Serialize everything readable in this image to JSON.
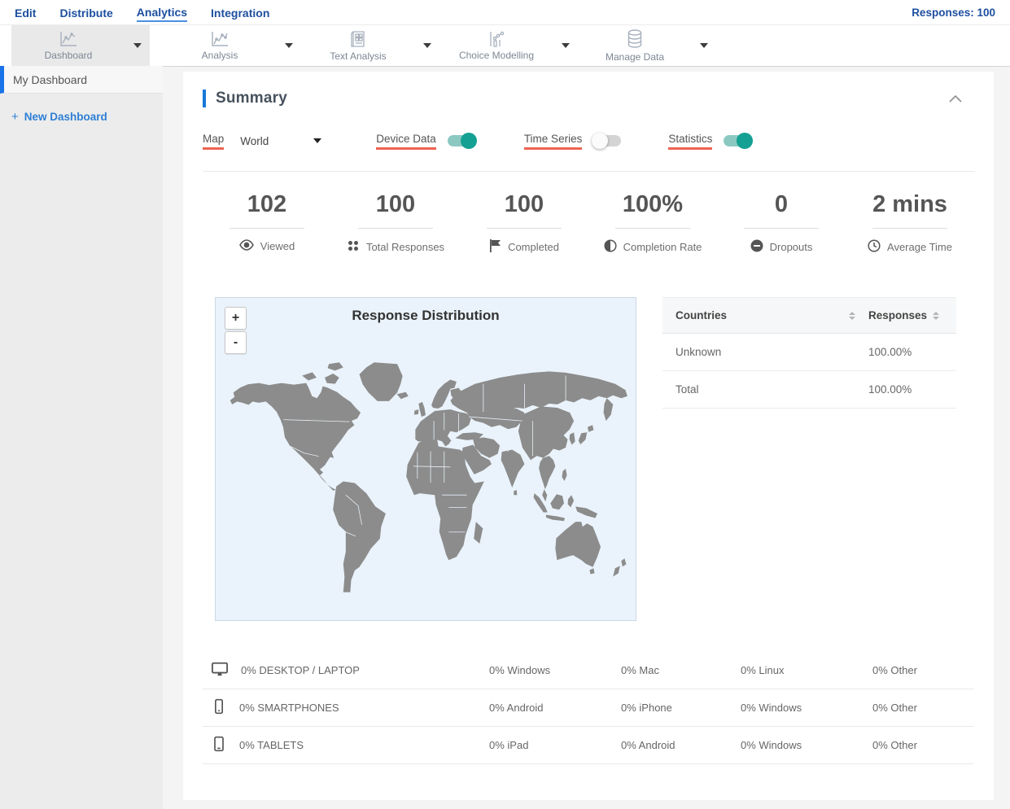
{
  "nav": {
    "items": [
      "Edit",
      "Distribute",
      "Analytics",
      "Integration"
    ],
    "active": "Analytics",
    "responses": "Responses: 100"
  },
  "toolbar": {
    "items": [
      {
        "label": "Dashboard",
        "icon": "dashboard-chart-icon",
        "selected": true
      },
      {
        "label": "Analysis",
        "icon": "analysis-chart-icon",
        "selected": false
      },
      {
        "label": "Text Analysis",
        "icon": "text-analysis-icon",
        "selected": false
      },
      {
        "label": "Choice Modelling",
        "icon": "choice-modelling-icon",
        "selected": false
      },
      {
        "label": "Manage Data",
        "icon": "database-icon",
        "selected": false
      }
    ]
  },
  "sidebar": {
    "my_dashboard": "My Dashboard",
    "plus": "+",
    "new_dashboard": "New Dashboard"
  },
  "summary": {
    "title": "Summary",
    "controls": {
      "map_label": "Map",
      "region_value": "World",
      "toggles": [
        {
          "label": "Device Data",
          "on": true
        },
        {
          "label": "Time Series",
          "on": false
        },
        {
          "label": "Statistics",
          "on": true
        }
      ]
    },
    "stats": [
      {
        "value": "102",
        "label": "Viewed",
        "icon": "eye-icon"
      },
      {
        "value": "100",
        "label": "Total Responses",
        "icon": "dots-grid-icon"
      },
      {
        "value": "100",
        "label": "Completed",
        "icon": "flag-icon"
      },
      {
        "value": "100%",
        "label": "Completion Rate",
        "icon": "half-circle-icon"
      },
      {
        "value": "0",
        "label": "Dropouts",
        "icon": "minus-circle-icon"
      },
      {
        "value": "2 mins",
        "label": "Average Time",
        "icon": "clock-icon"
      }
    ],
    "map": {
      "title": "Response Distribution",
      "zoom_in": "+",
      "zoom_out": "-",
      "background": "#eaf3fb",
      "land_color": "#8c8c8c"
    },
    "countries_table": {
      "headers": [
        "Countries",
        "Responses"
      ],
      "rows": [
        [
          "Unknown",
          "100.00%"
        ],
        [
          "Total",
          "100.00%"
        ]
      ]
    },
    "device_table": {
      "rows": [
        {
          "icon": "desktop-icon",
          "cells": [
            "0% DESKTOP / LAPTOP",
            "0% Windows",
            "0% Mac",
            "0% Linux",
            "0% Other"
          ]
        },
        {
          "icon": "smartphone-icon",
          "cells": [
            "0% SMARTPHONES",
            "0% Android",
            "0% iPhone",
            "0% Windows",
            "0% Other"
          ]
        },
        {
          "icon": "tablet-icon",
          "cells": [
            "0% TABLETS",
            "0% iPad",
            "0% Android",
            "0% Windows",
            "0% Other"
          ]
        }
      ]
    }
  },
  "colors": {
    "accent_blue": "#1a73e8",
    "nav_blue": "#1e4fa0",
    "toggle_on": "#14a093",
    "underline_red": "#ee6352"
  }
}
